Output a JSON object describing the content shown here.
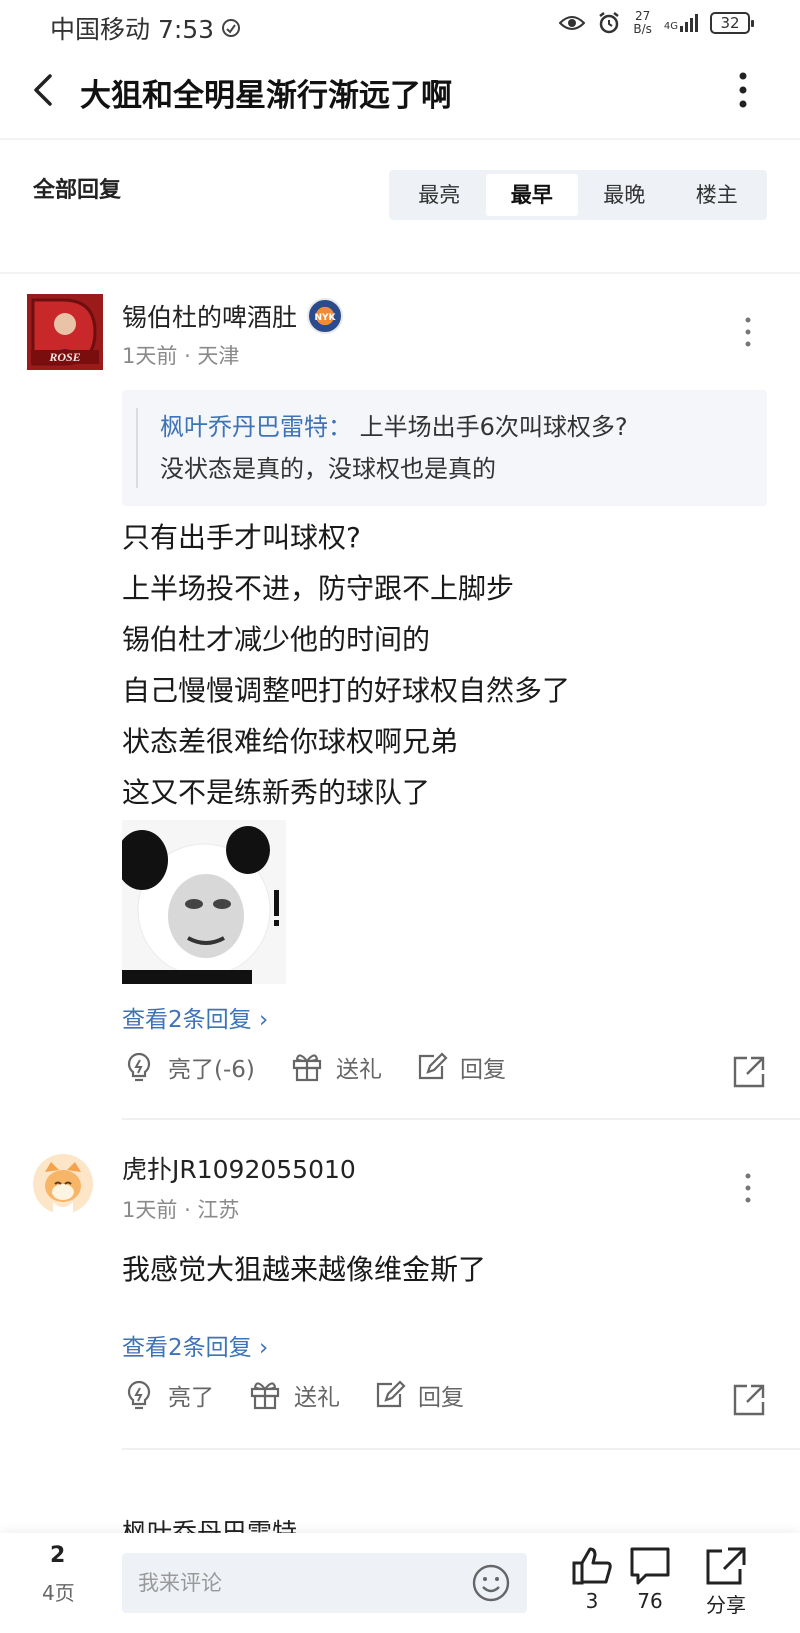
{
  "status_bar": {
    "carrier_time": "中国移动 7:53",
    "speed_value": "27",
    "speed_unit": "B/s",
    "network": "4G",
    "battery": "32"
  },
  "header": {
    "title": "大狙和全明星渐行渐远了啊"
  },
  "replies_head": {
    "label": "全部回复",
    "sort_tabs": [
      "最亮",
      "最早",
      "最晚",
      "楼主"
    ],
    "active_tab": "最早"
  },
  "comments": [
    {
      "author": "锡伯杜的啤酒肚",
      "badge_text": "NYK",
      "time": "1天前",
      "location": "天津",
      "quote_author": "枫叶乔丹巴雷特：",
      "quote_line1": "上半场出手6次叫球权多?",
      "quote_line2": "没状态是真的，没球权也是真的",
      "lines": [
        "只有出手才叫球权?",
        "上半场投不进，防守跟不上脚步",
        "锡伯杜才减少他的时间的",
        "自己慢慢调整吧打的好球权自然多了",
        "状态差很难给你球权啊兄弟",
        "这又不是练新秀的球队了"
      ],
      "view_replies": "查看2条回复 ›",
      "like": "亮了(-6)",
      "gift": "送礼",
      "reply": "回复"
    },
    {
      "author": "虎扑JR1092055010",
      "time": "1天前",
      "location": "江苏",
      "lines": [
        "我感觉大狙越来越像维金斯了"
      ],
      "view_replies": "查看2条回复 ›",
      "like": "亮了",
      "gift": "送礼",
      "reply": "回复"
    }
  ],
  "partial_next_author": "枫叶乔丹巴雷特",
  "bottom_bar": {
    "page_current": "2",
    "page_total": "4页",
    "comment_placeholder": "我来评论",
    "like_count": "3",
    "comment_count": "76",
    "share_label": "分享"
  },
  "colors": {
    "link_blue": "#3f73b8",
    "tab_bg": "#eef2f7"
  }
}
